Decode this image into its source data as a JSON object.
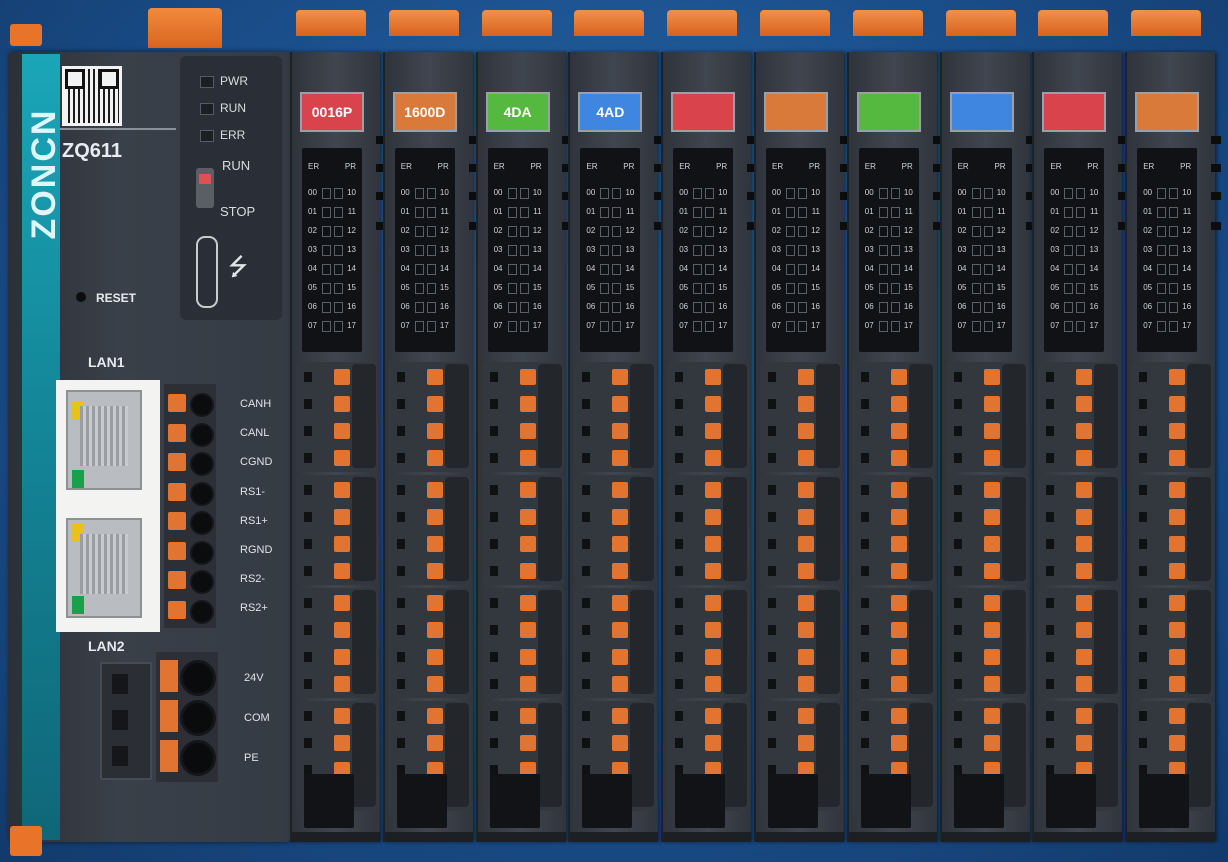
{
  "controller": {
    "brand": "ZONCN",
    "model": "ZQ611",
    "reset_label": "RESET",
    "leds": [
      "PWR",
      "RUN",
      "ERR"
    ],
    "switch_run": "RUN",
    "switch_stop": "STOP",
    "usb_icon": "usb-icon",
    "lan1": "LAN1",
    "lan2": "LAN2",
    "comm_terminals": [
      "CANH",
      "CANL",
      "CGND",
      "RS1-",
      "RS1+",
      "RGND",
      "RS2-",
      "RS2+"
    ],
    "power_terminals": [
      "24V",
      "COM",
      "PE"
    ]
  },
  "modules": [
    {
      "label": "0016P",
      "color": "#d9434b"
    },
    {
      "label": "1600D",
      "color": "#d97a3a"
    },
    {
      "label": "4DA",
      "color": "#55b83f"
    },
    {
      "label": "4AD",
      "color": "#3f86e0"
    },
    {
      "label": "",
      "color": "#d9434b"
    },
    {
      "label": "",
      "color": "#d97a3a"
    },
    {
      "label": "",
      "color": "#55b83f"
    },
    {
      "label": "",
      "color": "#3f86e0"
    },
    {
      "label": "",
      "color": "#d9434b"
    },
    {
      "label": "",
      "color": "#d97a3a"
    }
  ],
  "led_panel": {
    "header_left": "ER",
    "header_right": "PR",
    "left_channels": [
      "00",
      "01",
      "02",
      "03",
      "04",
      "05",
      "06",
      "07"
    ],
    "right_channels": [
      "10",
      "11",
      "12",
      "13",
      "14",
      "15",
      "16",
      "17"
    ]
  },
  "colors": {
    "accent_orange": "#e27432",
    "brand_teal": "#148a9c"
  }
}
